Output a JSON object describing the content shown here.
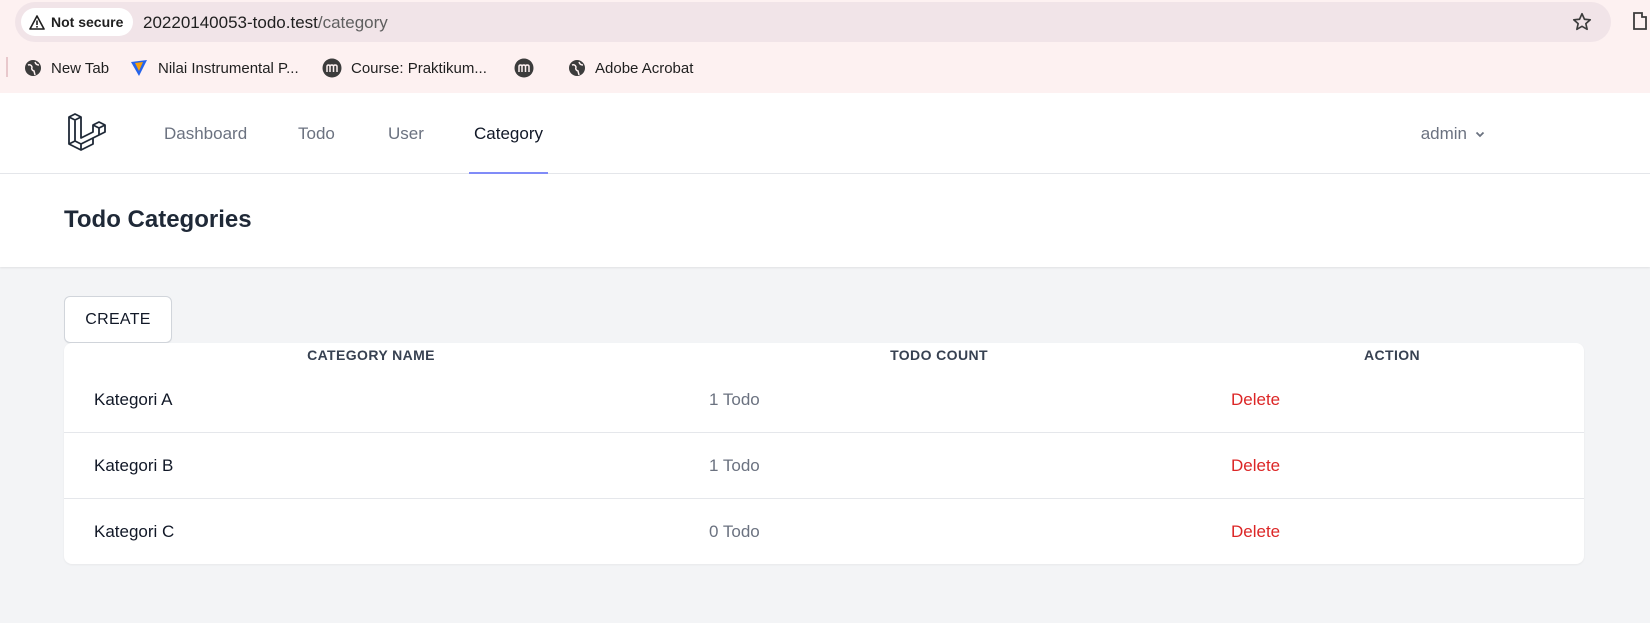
{
  "browser": {
    "security_label": "Not secure",
    "url_host": "20220140053-todo.test",
    "url_path": "/category",
    "bookmarks": [
      {
        "label": "New Tab",
        "icon": "globe-icon"
      },
      {
        "label": "Nilai Instrumental P...",
        "icon": "app-logo-icon"
      },
      {
        "label": "Course: Praktikum...",
        "icon": "moodle-icon"
      },
      {
        "label": "",
        "icon": "moodle-icon"
      },
      {
        "label": "Adobe Acrobat",
        "icon": "globe-icon"
      }
    ]
  },
  "nav": {
    "links": [
      {
        "label": "Dashboard",
        "active": false
      },
      {
        "label": "Todo",
        "active": false
      },
      {
        "label": "User",
        "active": false
      },
      {
        "label": "Category",
        "active": true
      }
    ],
    "user": "admin"
  },
  "page": {
    "title": "Todo Categories",
    "create_label": "CREATE"
  },
  "table": {
    "headers": [
      "CATEGORY NAME",
      "TODO COUNT",
      "ACTION"
    ],
    "rows": [
      {
        "name": "Kategori A",
        "count": "1 Todo",
        "action": "Delete"
      },
      {
        "name": "Kategori B",
        "count": "1 Todo",
        "action": "Delete"
      },
      {
        "name": "Kategori C",
        "count": "0 Todo",
        "action": "Delete"
      }
    ]
  },
  "colors": {
    "active_underline": "#818cf8",
    "delete": "#dc2626",
    "chrome_bg": "#fdf1f1"
  }
}
